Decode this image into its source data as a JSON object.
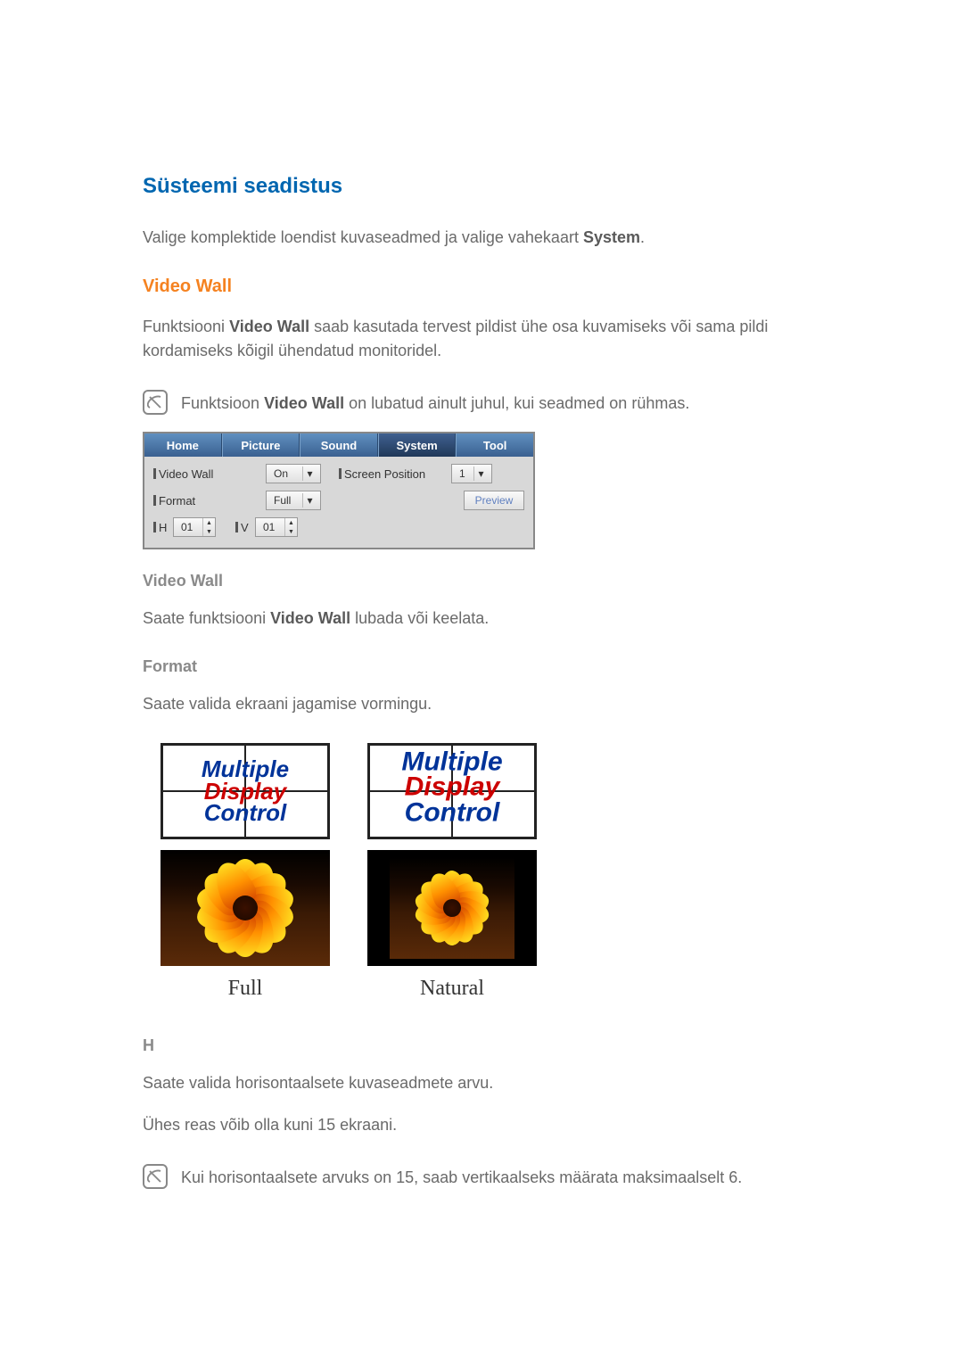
{
  "heading_primary": "Süsteemi seadistus",
  "intro_text_pre": "Valige komplektide loendist kuvaseadmed ja valige vahekaart ",
  "intro_text_bold": "System",
  "intro_text_post": ".",
  "section1_heading": "Video Wall",
  "section1_desc_pre": "Funktsiooni ",
  "section1_desc_bold": "Video Wall",
  "section1_desc_post": " saab kasutada tervest pildist ühe osa kuvamiseks või sama pildi kordamiseks kõigil ühendatud monitoridel.",
  "note1_pre": "Funktsioon ",
  "note1_bold": "Video Wall",
  "note1_post": " on lubatud ainult juhul, kui seadmed on rühmas.",
  "tabs": {
    "home": "Home",
    "picture": "Picture",
    "sound": "Sound",
    "system": "System",
    "tool": "Tool"
  },
  "panel": {
    "video_wall_label": "Video Wall",
    "video_wall_value": "On",
    "screen_position_label": "Screen Position",
    "screen_position_value": "1",
    "format_label": "Format",
    "format_value": "Full",
    "preview_label": "Preview",
    "h_label": "H",
    "h_value": "01",
    "v_label": "V",
    "v_value": "01"
  },
  "sub_video_wall_heading": "Video Wall",
  "sub_video_wall_text_pre": "Saate funktsiooni ",
  "sub_video_wall_text_bold": "Video Wall",
  "sub_video_wall_text_post": " lubada või keelata.",
  "sub_format_heading": "Format",
  "sub_format_text": "Saate valida ekraani jagamise vormingu.",
  "format_diagram_text": {
    "line1": "Multiple",
    "line2": "Display",
    "line3": "Control"
  },
  "format_labels": {
    "full": "Full",
    "natural": "Natural"
  },
  "sub_h_heading": "H",
  "sub_h_text1": "Saate valida horisontaalsete kuvaseadmete arvu.",
  "sub_h_text2": "Ühes reas võib olla kuni 15 ekraani.",
  "note2": "Kui horisontaalsete arvuks on 15, saab vertikaalseks määrata maksimaalselt 6."
}
